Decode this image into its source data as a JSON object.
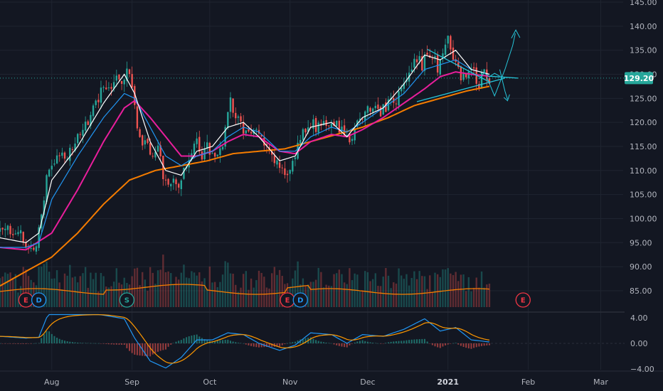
{
  "chart_data": {
    "type": "candlestick",
    "current_price": 129.2,
    "current_price_label": "129.20",
    "price_axis": {
      "ylim": [
        81,
        145
      ],
      "ticks": [
        "85.00",
        "90.00",
        "95.00",
        "100.00",
        "105.00",
        "110.00",
        "115.00",
        "120.00",
        "125.00",
        "130.00",
        "135.00",
        "140.00",
        "145.00"
      ]
    },
    "macd_axis": {
      "ylim": [
        -5.4,
        5.4
      ],
      "ticks": [
        "4.00",
        "0.00",
        "−4.00"
      ]
    },
    "time_axis": {
      "labels": [
        {
          "label": "Aug",
          "day": 20,
          "bold": false
        },
        {
          "label": "Sep",
          "day": 51,
          "bold": false
        },
        {
          "label": "Oct",
          "day": 81,
          "bold": false
        },
        {
          "label": "Nov",
          "day": 112,
          "bold": false
        },
        {
          "label": "Dec",
          "day": 142,
          "bold": false
        },
        {
          "label": "2021",
          "day": 173,
          "bold": true
        },
        {
          "label": "Feb",
          "day": 204,
          "bold": false
        },
        {
          "label": "Mar",
          "day": 232,
          "bold": false
        }
      ]
    },
    "price_anchors": [
      [
        0,
        97
      ],
      [
        3,
        97.5
      ],
      [
        7,
        98
      ],
      [
        10,
        93
      ],
      [
        13,
        94
      ],
      [
        15,
        97
      ],
      [
        18,
        108
      ],
      [
        20,
        111
      ],
      [
        24,
        113
      ],
      [
        28,
        114
      ],
      [
        31,
        118
      ],
      [
        34,
        120
      ],
      [
        37,
        124
      ],
      [
        40,
        127
      ],
      [
        43,
        128
      ],
      [
        45,
        131
      ],
      [
        47,
        128
      ],
      [
        49,
        132
      ],
      [
        51,
        127
      ],
      [
        53,
        118
      ],
      [
        55,
        115
      ],
      [
        57,
        116
      ],
      [
        59,
        112
      ],
      [
        61,
        114
      ],
      [
        64,
        107
      ],
      [
        66,
        108
      ],
      [
        68,
        106
      ],
      [
        70,
        108
      ],
      [
        72,
        111
      ],
      [
        74,
        114
      ],
      [
        76,
        116
      ],
      [
        78,
        113
      ],
      [
        80,
        115
      ],
      [
        82,
        114
      ],
      [
        85,
        114
      ],
      [
        87,
        118
      ],
      [
        89,
        124
      ],
      [
        91,
        122
      ],
      [
        93,
        119
      ],
      [
        95,
        118
      ],
      [
        98,
        118
      ],
      [
        100,
        117
      ],
      [
        102,
        116
      ],
      [
        104,
        115
      ],
      [
        106,
        112
      ],
      [
        108,
        110
      ],
      [
        110,
        110
      ],
      [
        112,
        110
      ],
      [
        114,
        112
      ],
      [
        116,
        117
      ],
      [
        118,
        119
      ],
      [
        120,
        120
      ],
      [
        122,
        119
      ],
      [
        124,
        119
      ],
      [
        126,
        120
      ],
      [
        129,
        120
      ],
      [
        131,
        119
      ],
      [
        133,
        117
      ],
      [
        135,
        116
      ],
      [
        137,
        118
      ],
      [
        139,
        121
      ],
      [
        141,
        123
      ],
      [
        143,
        122
      ],
      [
        145,
        123
      ],
      [
        147,
        122
      ],
      [
        149,
        123
      ],
      [
        151,
        124
      ],
      [
        153,
        125
      ],
      [
        155,
        128
      ],
      [
        157,
        128
      ],
      [
        159,
        131
      ],
      [
        161,
        133
      ],
      [
        163,
        132
      ],
      [
        165,
        135
      ],
      [
        167,
        134
      ],
      [
        169,
        131
      ],
      [
        171,
        134
      ],
      [
        173,
        138
      ],
      [
        175,
        134
      ],
      [
        177,
        131
      ],
      [
        179,
        129
      ],
      [
        181,
        131
      ],
      [
        183,
        130
      ],
      [
        185,
        128
      ],
      [
        187,
        131
      ],
      [
        189,
        129
      ]
    ],
    "ema_fast_anchors": [
      [
        0,
        96
      ],
      [
        10,
        95
      ],
      [
        15,
        97
      ],
      [
        20,
        108
      ],
      [
        30,
        115
      ],
      [
        40,
        124
      ],
      [
        48,
        130
      ],
      [
        52,
        126
      ],
      [
        58,
        116
      ],
      [
        64,
        110
      ],
      [
        70,
        109
      ],
      [
        76,
        114
      ],
      [
        82,
        115
      ],
      [
        88,
        119
      ],
      [
        94,
        120
      ],
      [
        100,
        117
      ],
      [
        108,
        112
      ],
      [
        114,
        113
      ],
      [
        120,
        119
      ],
      [
        128,
        120
      ],
      [
        134,
        117
      ],
      [
        140,
        121
      ],
      [
        148,
        123
      ],
      [
        156,
        128
      ],
      [
        164,
        134
      ],
      [
        170,
        133
      ],
      [
        176,
        135
      ],
      [
        182,
        131
      ],
      [
        189,
        130
      ]
    ],
    "ema_mid_anchors": [
      [
        0,
        94
      ],
      [
        10,
        94
      ],
      [
        15,
        95
      ],
      [
        20,
        104
      ],
      [
        30,
        113
      ],
      [
        40,
        121
      ],
      [
        48,
        126
      ],
      [
        52,
        125
      ],
      [
        58,
        119
      ],
      [
        64,
        113
      ],
      [
        70,
        111
      ],
      [
        76,
        113
      ],
      [
        82,
        114
      ],
      [
        88,
        117
      ],
      [
        94,
        119
      ],
      [
        100,
        118
      ],
      [
        108,
        114
      ],
      [
        114,
        114
      ],
      [
        120,
        117
      ],
      [
        128,
        119
      ],
      [
        134,
        118
      ],
      [
        140,
        120
      ],
      [
        148,
        123
      ],
      [
        156,
        126
      ],
      [
        164,
        131
      ],
      [
        170,
        132
      ],
      [
        176,
        133
      ],
      [
        182,
        131
      ],
      [
        189,
        130
      ]
    ],
    "sma50_anchors": [
      [
        0,
        94
      ],
      [
        10,
        93.5
      ],
      [
        20,
        97
      ],
      [
        30,
        106
      ],
      [
        40,
        116
      ],
      [
        48,
        123
      ],
      [
        52,
        124.5
      ],
      [
        58,
        121
      ],
      [
        64,
        117
      ],
      [
        70,
        113
      ],
      [
        76,
        113
      ],
      [
        82,
        114
      ],
      [
        88,
        116
      ],
      [
        94,
        117.5
      ],
      [
        100,
        117
      ],
      [
        108,
        114
      ],
      [
        114,
        113.5
      ],
      [
        120,
        116
      ],
      [
        128,
        117.5
      ],
      [
        134,
        117
      ],
      [
        140,
        118.5
      ],
      [
        148,
        121
      ],
      [
        156,
        124
      ],
      [
        164,
        127
      ],
      [
        170,
        129.5
      ],
      [
        176,
        130.5
      ],
      [
        182,
        130
      ],
      [
        189,
        129.6
      ]
    ],
    "sma200_anchors": [
      [
        0,
        86
      ],
      [
        10,
        89
      ],
      [
        20,
        92
      ],
      [
        30,
        97
      ],
      [
        40,
        103
      ],
      [
        50,
        108
      ],
      [
        60,
        110
      ],
      [
        70,
        111
      ],
      [
        80,
        112
      ],
      [
        90,
        113.5
      ],
      [
        100,
        114
      ],
      [
        110,
        114.5
      ],
      [
        120,
        116
      ],
      [
        130,
        117.5
      ],
      [
        140,
        119
      ],
      [
        150,
        121
      ],
      [
        160,
        123.5
      ],
      [
        170,
        125
      ],
      [
        180,
        126.5
      ],
      [
        189,
        127.5
      ]
    ],
    "triangle": {
      "upper": [
        [
          165,
          135.2
        ],
        [
          189,
          128.4
        ]
      ],
      "lower": [
        [
          161,
          124.3
        ],
        [
          195,
          129.2
        ]
      ],
      "pointer_line": [
        [
          189,
          129.6
        ],
        [
          200,
          129.2
        ]
      ]
    },
    "events": [
      {
        "label": "E",
        "day": 10,
        "color": "#f23645"
      },
      {
        "label": "D",
        "day": 15,
        "color": "#2196f3"
      },
      {
        "label": "S",
        "day": 49,
        "color": "#26a69a"
      },
      {
        "label": "E",
        "day": 111,
        "color": "#f23645"
      },
      {
        "label": "D",
        "day": 116,
        "color": "#2196f3"
      },
      {
        "label": "E",
        "day": 202,
        "color": "#f23645"
      }
    ],
    "legend_placement": "none",
    "grid": true
  },
  "colors": {
    "background": "#131722",
    "grid": "#1f2430",
    "up": "#26a69a",
    "down": "#ef5350",
    "ema_fast": "#ffffff",
    "ema_mid": "#2196f3",
    "sma50": "#e91e9c",
    "sma200": "#f57c00",
    "volume_ma": "#f57c00",
    "macd": "#2196f3",
    "signal": "#ff9800",
    "triangle": "#26c6da",
    "price_tag": "#26a69a"
  }
}
